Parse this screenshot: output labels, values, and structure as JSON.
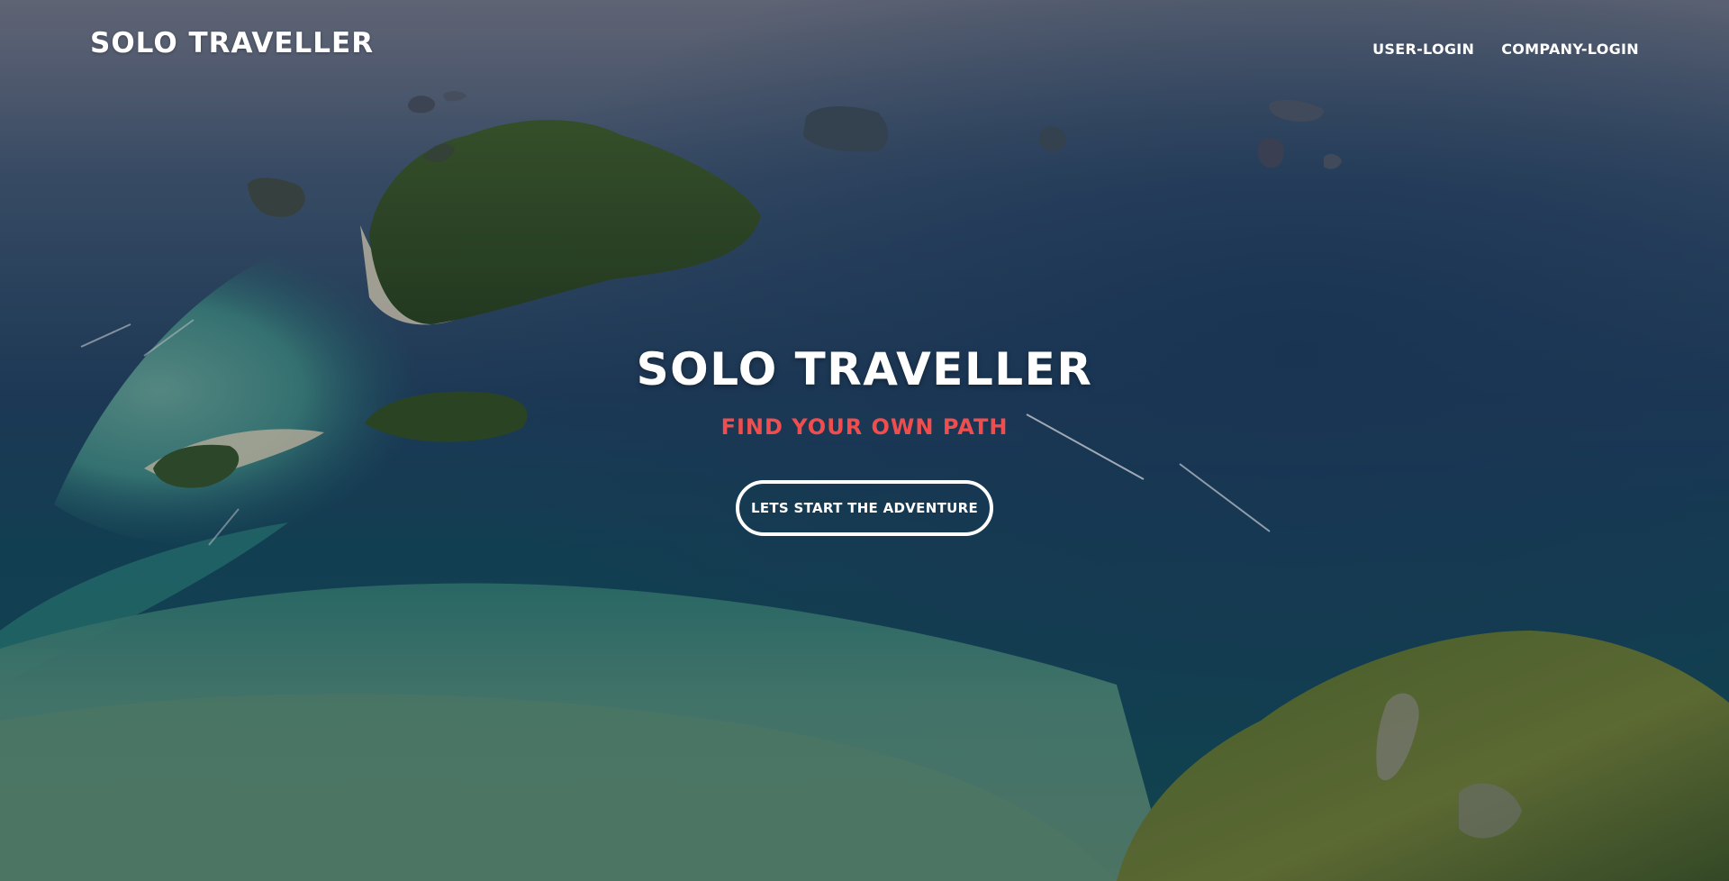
{
  "navbar": {
    "brand": "SOLO TRAVELLER",
    "links": [
      {
        "label": "USER-LOGIN"
      },
      {
        "label": "COMPANY-LOGIN"
      }
    ]
  },
  "hero": {
    "title": "SOLO TRAVELLER",
    "subtitle": "FIND YOUR OWN PATH",
    "cta_label": "LETS START THE ADVENTURE"
  },
  "colors": {
    "accent": "#f04e4e",
    "text": "#ffffff"
  }
}
